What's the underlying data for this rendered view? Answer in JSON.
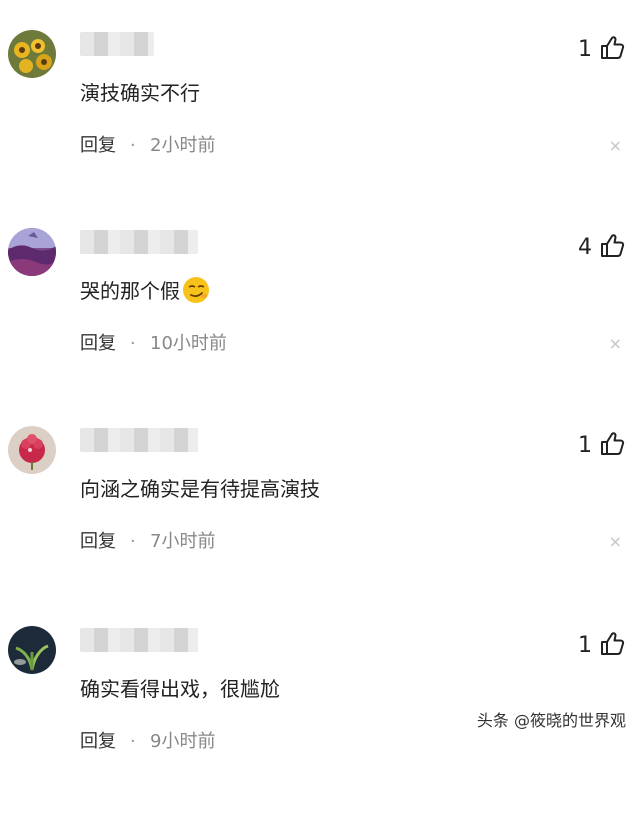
{
  "comments": [
    {
      "username": "",
      "likes": "1",
      "text": "演技确实不行",
      "reply_label": "回复",
      "separator": "·",
      "time": "2小时前",
      "close": "×",
      "avatar": "sunflower-avatar",
      "has_emoji": false
    },
    {
      "username": "",
      "likes": "4",
      "text": "哭的那个假",
      "reply_label": "回复",
      "separator": "·",
      "time": "10小时前",
      "close": "×",
      "avatar": "purple-landscape-avatar",
      "has_emoji": true,
      "emoji": "smirk-emoji-icon"
    },
    {
      "username": "",
      "likes": "1",
      "text": "向涵之确实是有待提高演技",
      "reply_label": "回复",
      "separator": "·",
      "time": "7小时前",
      "close": "×",
      "avatar": "pink-flower-avatar",
      "has_emoji": false
    },
    {
      "username": "",
      "likes": "1",
      "text": "确实看得出戏，很尴尬",
      "reply_label": "回复",
      "separator": "·",
      "time": "9小时前",
      "close": "×",
      "avatar": "dark-plant-avatar",
      "has_emoji": false
    }
  ],
  "watermark": "头条 @筱晓的世界观",
  "colors": {
    "text": "#222222",
    "meta": "#888888",
    "close": "#c4c4c4"
  }
}
